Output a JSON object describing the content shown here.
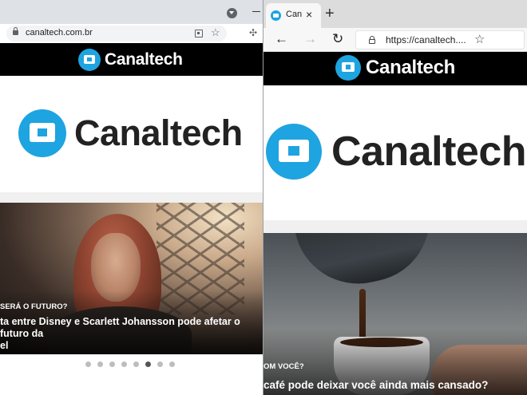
{
  "left_browser": {
    "url": "canaltech.com.br",
    "site_brand": "Canaltech",
    "hero_brand": "Canaltech",
    "slide": {
      "kicker": "SERÁ O FUTURO?",
      "headline": "ta entre Disney e Scarlett Johansson pode afetar o futuro da\nel",
      "dot_count": 8,
      "active_dot": 5
    }
  },
  "right_browser": {
    "tab_title": "Canaltech",
    "tab_close": "×",
    "new_tab": "+",
    "url": "https://canaltech....",
    "site_brand": "Canaltech",
    "hero_brand": "Canaltech",
    "slide": {
      "kicker": "OM VOCÊ?",
      "headline": "café pode deixar você ainda mais cansado?"
    }
  },
  "icons": {
    "left_star": "☆",
    "left_extensions": "✣",
    "right_back": "←",
    "right_forward": "→",
    "right_reload": "↻",
    "right_favorite": "☆"
  },
  "colors": {
    "brand_blue": "#1ea4e0",
    "header_black": "#000000"
  }
}
